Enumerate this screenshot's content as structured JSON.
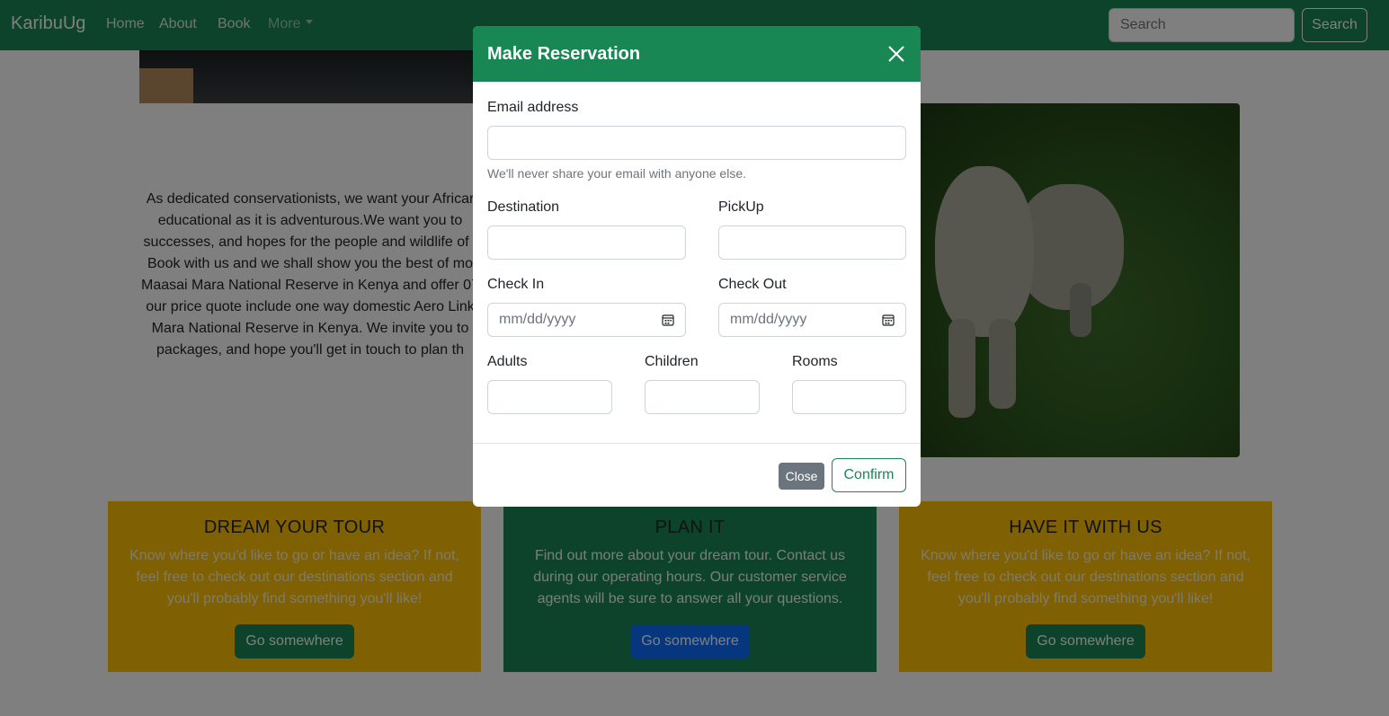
{
  "navbar": {
    "brand": "KaribuUg",
    "links": [
      "Home",
      "About",
      "Book"
    ],
    "more_label": "More",
    "search_placeholder": "Search",
    "search_button": "Search"
  },
  "intro": {
    "text": "As dedicated conservationists, we want your Africar\neducational as it is adventurous.We want you to\nsuccesses, and hopes for the people and wildlife of t\nBook with us and we shall show you the best of mo\nMaasai Mara National Reserve in Kenya and offer 07\nour price quote include one way domestic Aero Link\nMara National Reserve in Kenya. We invite you to\npackages, and hope you'll get in touch to plan th"
  },
  "cards": [
    {
      "title": "DREAM YOUR TOUR",
      "text": "Know where you'd like to go or have an idea? If not,\nfeel free to check out our destinations section and\nyou'll probably find something you'll like!",
      "button": "Go somewhere"
    },
    {
      "title": "PLAN IT",
      "text": "Find out more about your dream tour. Contact us\nduring our operating hours. Our customer service\nagents will be sure to answer all your questions.",
      "button": "Go somewhere"
    },
    {
      "title": "HAVE IT WITH US",
      "text": "Know where you'd like to go or have an idea? If not,\nfeel free to check out our destinations section and\nyou'll probably find something you'll like!",
      "button": "Go somewhere"
    }
  ],
  "modal": {
    "title": "Make Reservation",
    "email_label": "Email address",
    "email_value": "",
    "email_help": "We'll never share your email with anyone else.",
    "destination_label": "Destination",
    "destination_value": "",
    "pickup_label": "PickUp",
    "pickup_value": "",
    "checkin_label": "Check In",
    "checkin_placeholder": "mm/dd/yyyy",
    "checkout_label": "Check Out",
    "checkout_placeholder": "mm/dd/yyyy",
    "adults_label": "Adults",
    "children_label": "Children",
    "rooms_label": "Rooms",
    "close_button": "Close",
    "confirm_button": "Confirm"
  },
  "colors": {
    "primary_green": "#198754",
    "accent_yellow": "#ffc107",
    "primary_blue": "#0d6efd",
    "secondary_gray": "#6c757d"
  },
  "icons": [
    "close-icon",
    "calendar-icon",
    "chevron-down-icon"
  ]
}
